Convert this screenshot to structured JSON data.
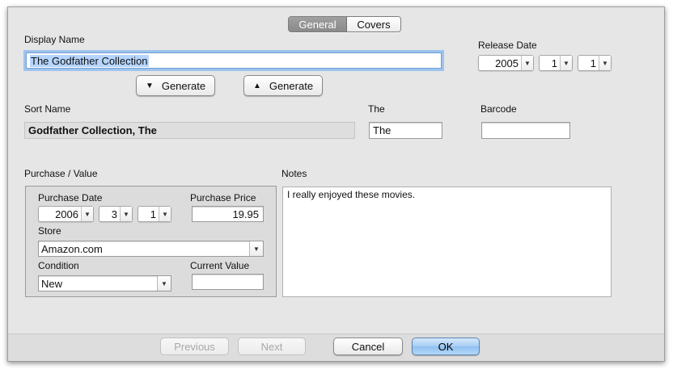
{
  "tabs": {
    "general": "General",
    "covers": "Covers"
  },
  "display_name": {
    "label": "Display Name",
    "value": "The Godfather Collection"
  },
  "generate_buttons": {
    "down_label": "Generate",
    "up_label": "Generate"
  },
  "release_date": {
    "label": "Release Date",
    "year": "2005",
    "month": "1",
    "day": "1"
  },
  "sort_name": {
    "label": "Sort Name",
    "value": "Godfather Collection, The"
  },
  "the_field": {
    "label": "The",
    "value": "The"
  },
  "barcode": {
    "label": "Barcode",
    "value": ""
  },
  "purchase": {
    "section_label": "Purchase / Value",
    "date_label": "Purchase Date",
    "year": "2006",
    "month": "3",
    "day": "1",
    "price_label": "Purchase Price",
    "price": "19.95",
    "store_label": "Store",
    "store": "Amazon.com",
    "condition_label": "Condition",
    "condition": "New",
    "current_value_label": "Current Value",
    "current_value": ""
  },
  "notes": {
    "label": "Notes",
    "text": "I really enjoyed these movies."
  },
  "footer": {
    "previous": "Previous",
    "next": "Next",
    "cancel": "Cancel",
    "ok": "OK"
  },
  "icons": {
    "dropdown": "▼",
    "arrow_down": "▼",
    "arrow_up": "▲"
  },
  "colors": {
    "selection": "#b5d5ff",
    "focus_ring": "#9dc3ee",
    "default_button": "#a7cdf3"
  }
}
